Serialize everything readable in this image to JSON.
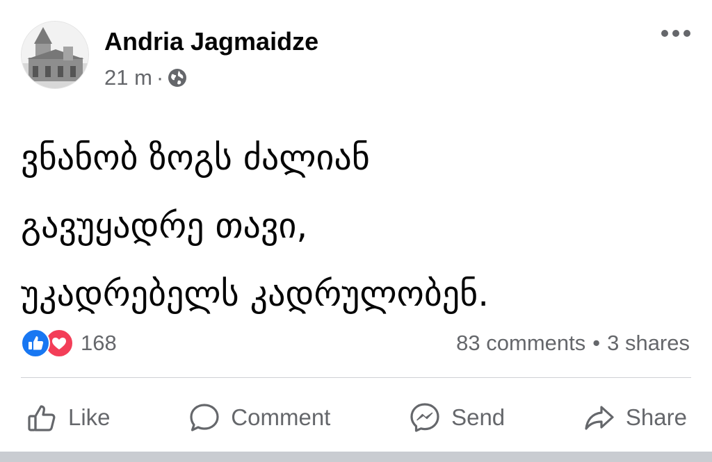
{
  "post": {
    "author": "Andria Jagmaidze",
    "time": "21 m",
    "separator": "·",
    "privacy_icon": "globe-icon",
    "more_icon": "more-horizontal-icon",
    "text_lines": [
      "ვნანობ ზოგს ძალიან",
      "გავუყადრე თავი,",
      "უკადრებელს კადრულობენ."
    ]
  },
  "engagement": {
    "reaction_icons": [
      "like-reaction-icon",
      "love-reaction-icon"
    ],
    "reaction_count": "168",
    "comments": "83 comments",
    "dot": "•",
    "shares": "3 shares"
  },
  "actions": {
    "like": "Like",
    "comment": "Comment",
    "send": "Send",
    "share": "Share"
  },
  "colors": {
    "text": "#050505",
    "secondary": "#65676b",
    "like_blue": "#1877f2",
    "love_red": "#f33e58",
    "divider": "#ced0d4"
  }
}
